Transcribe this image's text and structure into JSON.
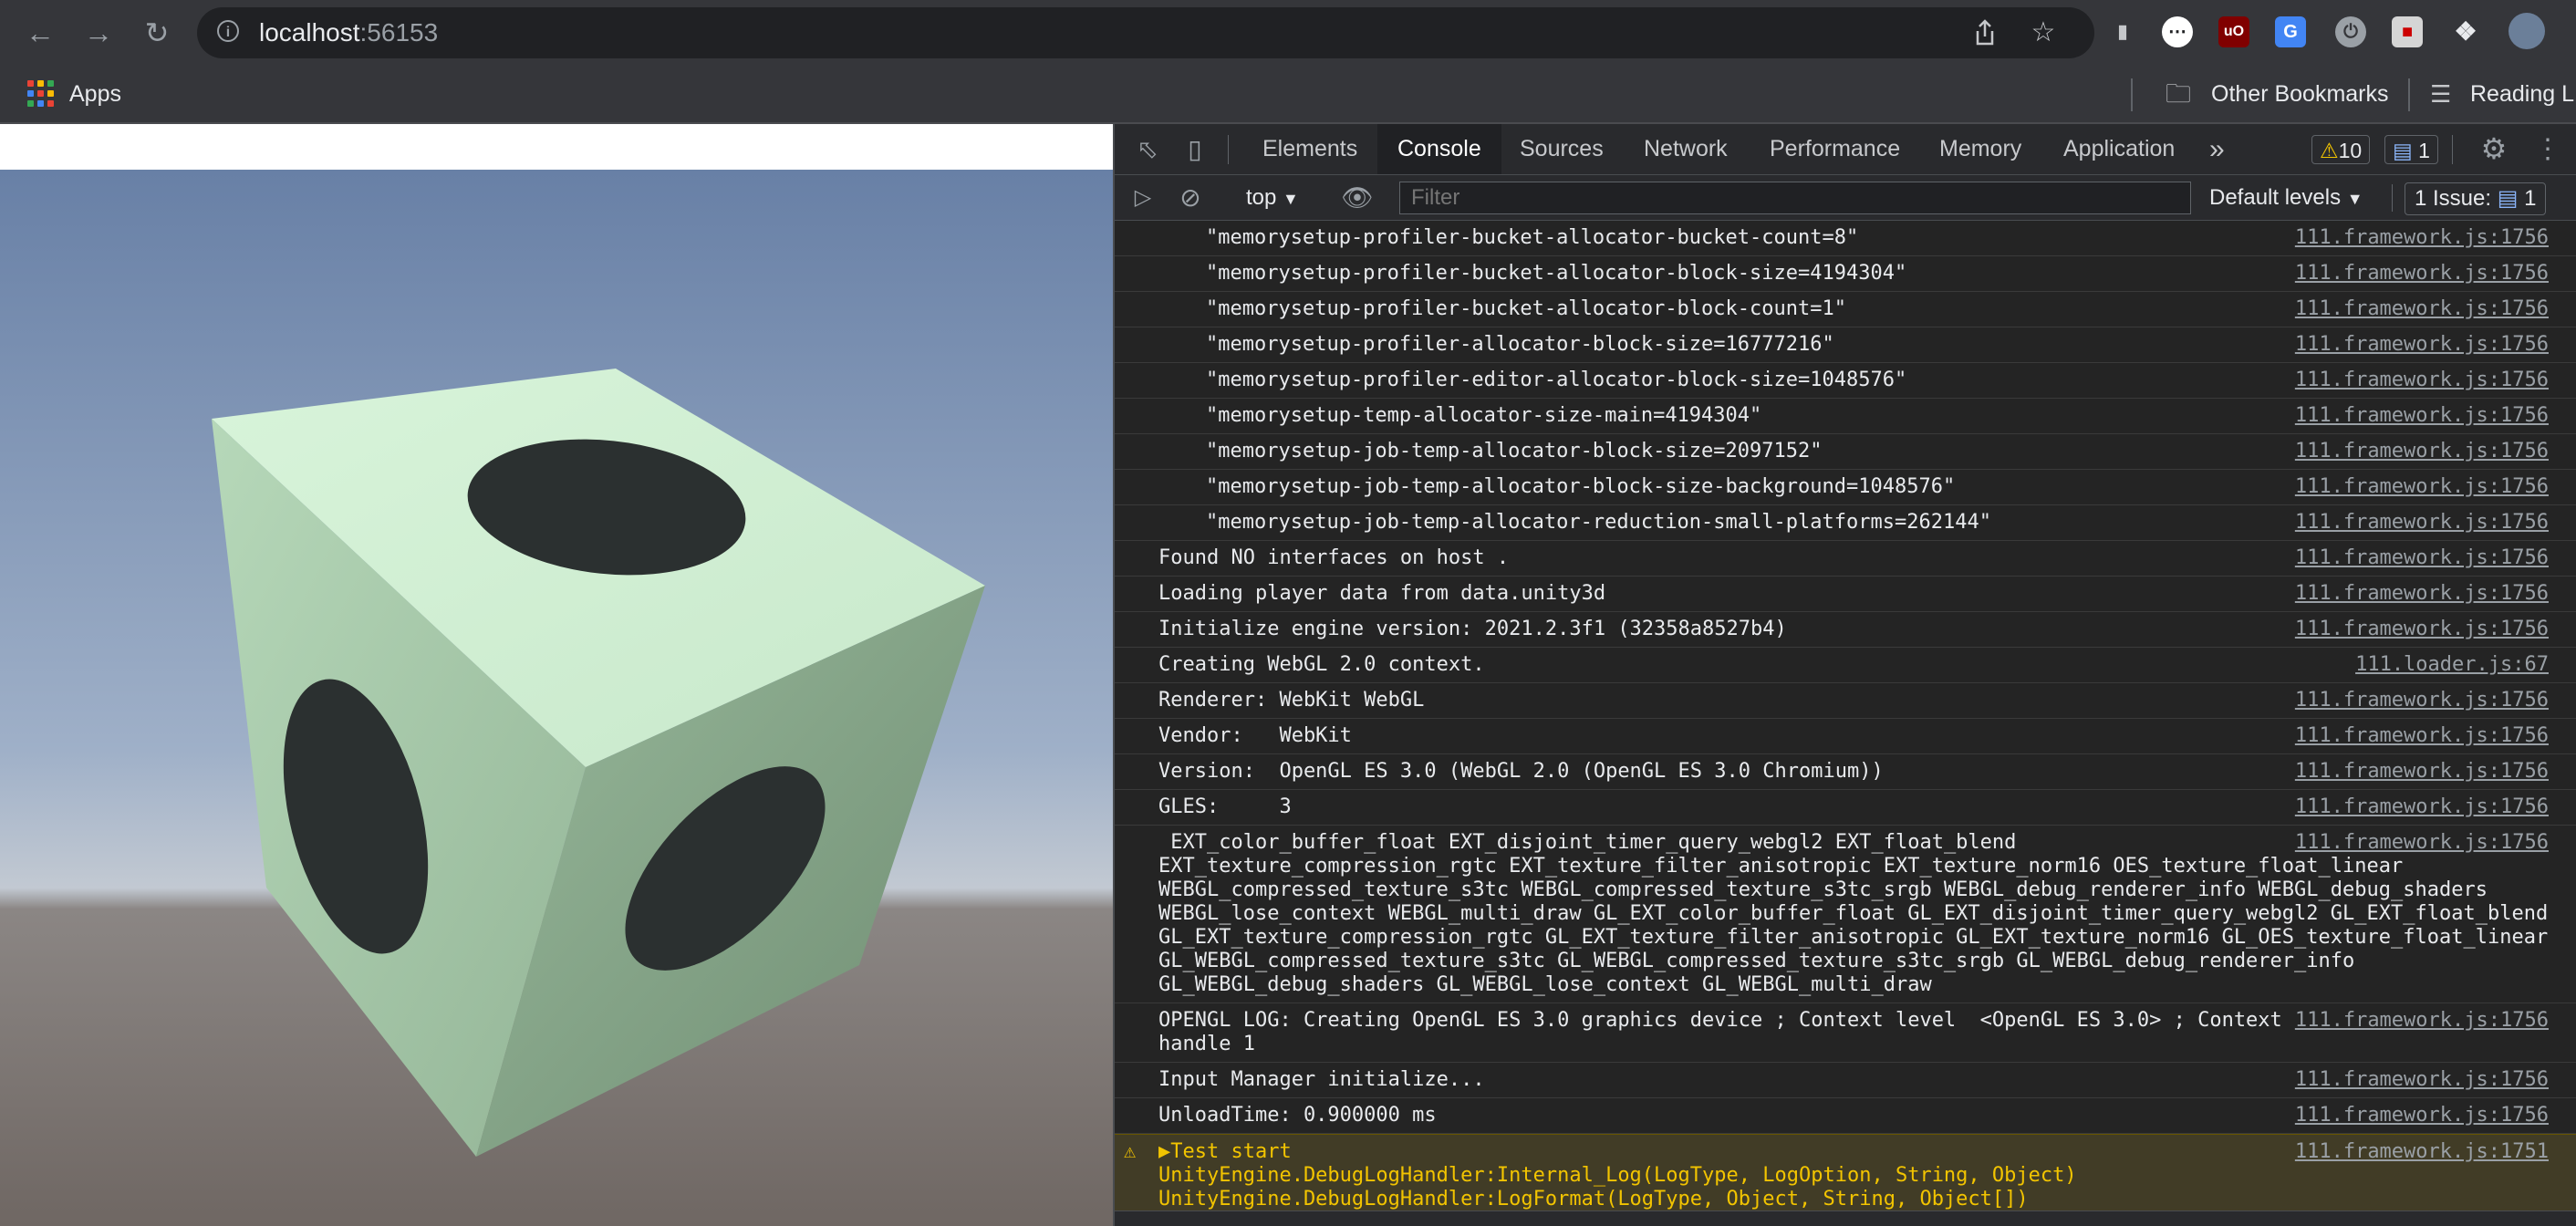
{
  "browser": {
    "url_host": "localhost",
    "url_port": ":56153",
    "bookmarks": {
      "apps_label": "Apps",
      "other_label": "Other Bookmarks",
      "reading_label": "Reading L"
    },
    "icons": [
      "back-icon",
      "forward-icon",
      "reload-icon",
      "info-icon",
      "share-icon",
      "star-icon",
      "extension-icon",
      "profile-avatar"
    ]
  },
  "devtools": {
    "tabs": [
      "Elements",
      "Console",
      "Sources",
      "Network",
      "Performance",
      "Memory",
      "Application"
    ],
    "active_tab": "Console",
    "more_tabs": "»",
    "warnings_count": "10",
    "messages_count": "1",
    "context": "top",
    "filter_placeholder": "Filter",
    "levels": "Default levels",
    "issues_label": "1 Issue:",
    "issues_count": "1"
  },
  "console": {
    "rows": [
      {
        "text": "\"memorysetup-profiler-bucket-allocator-bucket-count=8\"",
        "src": "111.framework.js:1756",
        "indent": true
      },
      {
        "text": "\"memorysetup-profiler-bucket-allocator-block-size=4194304\"",
        "src": "111.framework.js:1756",
        "indent": true
      },
      {
        "text": "\"memorysetup-profiler-bucket-allocator-block-count=1\"",
        "src": "111.framework.js:1756",
        "indent": true
      },
      {
        "text": "\"memorysetup-profiler-allocator-block-size=16777216\"",
        "src": "111.framework.js:1756",
        "indent": true
      },
      {
        "text": "\"memorysetup-profiler-editor-allocator-block-size=1048576\"",
        "src": "111.framework.js:1756",
        "indent": true
      },
      {
        "text": "\"memorysetup-temp-allocator-size-main=4194304\"",
        "src": "111.framework.js:1756",
        "indent": true
      },
      {
        "text": "\"memorysetup-job-temp-allocator-block-size=2097152\"",
        "src": "111.framework.js:1756",
        "indent": true
      },
      {
        "text": "\"memorysetup-job-temp-allocator-block-size-background=1048576\"",
        "src": "111.framework.js:1756",
        "indent": true
      },
      {
        "text": "\"memorysetup-job-temp-allocator-reduction-small-platforms=262144\"",
        "src": "111.framework.js:1756",
        "indent": true
      },
      {
        "text": "Found NO interfaces on host .",
        "src": "111.framework.js:1756"
      },
      {
        "text": "Loading player data from data.unity3d",
        "src": "111.framework.js:1756"
      },
      {
        "text": "Initialize engine version: 2021.2.3f1 (32358a8527b4)",
        "src": "111.framework.js:1756"
      },
      {
        "text": "Creating WebGL 2.0 context.",
        "src": "111.loader.js:67"
      },
      {
        "text": "Renderer: WebKit WebGL",
        "src": "111.framework.js:1756"
      },
      {
        "text": "Vendor:   WebKit",
        "src": "111.framework.js:1756"
      },
      {
        "text": "Version:  OpenGL ES 3.0 (WebGL 2.0 (OpenGL ES 3.0 Chromium))",
        "src": "111.framework.js:1756"
      },
      {
        "text": "GLES:     3",
        "src": "111.framework.js:1756"
      },
      {
        "text": " EXT_color_buffer_float EXT_disjoint_timer_query_webgl2 EXT_float_blend\nEXT_texture_compression_rgtc EXT_texture_filter_anisotropic EXT_texture_norm16 OES_texture_float_linear\nWEBGL_compressed_texture_s3tc WEBGL_compressed_texture_s3tc_srgb WEBGL_debug_renderer_info WEBGL_debug_shaders\nWEBGL_lose_context WEBGL_multi_draw GL_EXT_color_buffer_float GL_EXT_disjoint_timer_query_webgl2 GL_EXT_float_blend\nGL_EXT_texture_compression_rgtc GL_EXT_texture_filter_anisotropic GL_EXT_texture_norm16 GL_OES_texture_float_linear\nGL_WEBGL_compressed_texture_s3tc GL_WEBGL_compressed_texture_s3tc_srgb GL_WEBGL_debug_renderer_info\nGL_WEBGL_debug_shaders GL_WEBGL_lose_context GL_WEBGL_multi_draw",
        "src": "111.framework.js:1756",
        "wide": true
      },
      {
        "text": "OPENGL LOG: Creating OpenGL ES 3.0 graphics device ; Context level  <OpenGL ES 3.0> ; Context\nhandle 1",
        "src": "111.framework.js:1756"
      },
      {
        "text": "Input Manager initialize...",
        "src": "111.framework.js:1756"
      },
      {
        "text": "UnloadTime: 0.900000 ms",
        "src": "111.framework.js:1756"
      },
      {
        "text": "▶Test start\nUnityEngine.DebugLogHandler:Internal_Log(LogType, LogOption, String, Object)\nUnityEngine.DebugLogHandler:LogFormat(LogType, Object, String, Object[])",
        "src": "111.framework.js:1751",
        "warn": true
      }
    ]
  },
  "colors": {
    "chrome_bg": "#35363a",
    "devtools_bg": "#242424",
    "warning": "#f2c400",
    "sky_top": "#6d86ab",
    "ground": "#7a736f",
    "cube_top": "#d3f2d6",
    "cube_left": "#a5c6a8",
    "cube_right": "#86a688",
    "spot": "#2a2f30"
  }
}
